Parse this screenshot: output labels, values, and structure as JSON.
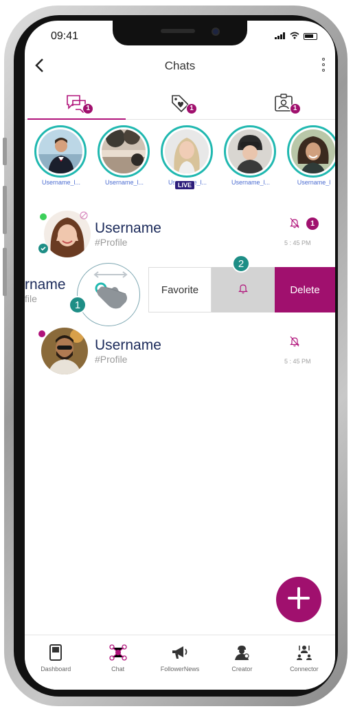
{
  "status_bar": {
    "time": "09:41"
  },
  "header": {
    "title": "Chats"
  },
  "tabs": [
    {
      "icon": "chat-bubbles-icon",
      "badge": "1",
      "active": true
    },
    {
      "icon": "heart-tag-icon",
      "badge": "1",
      "active": false
    },
    {
      "icon": "contact-card-icon",
      "badge": "1",
      "active": false
    }
  ],
  "stories": [
    {
      "label": "Username_l...",
      "live": false
    },
    {
      "label": "Username_l...",
      "live": false
    },
    {
      "label": "Username_l...",
      "live": true,
      "live_text": "LIVE"
    },
    {
      "label": "Username_l...",
      "live": false
    },
    {
      "label": "Username_l",
      "live": false
    }
  ],
  "chats": [
    {
      "name": "Username",
      "profile": "#Profile",
      "time": "5 : 45 PM",
      "unread": "1",
      "muted": true
    },
    {
      "name": "Username",
      "profile": "#Profile",
      "time": "5 : 45 PM",
      "muted": true
    }
  ],
  "swiped_chat": {
    "name_partial": "rname",
    "profile_partial": "file"
  },
  "swipe_actions": {
    "favorite": "Favorite",
    "mute_icon": "bell-icon",
    "delete": "Delete"
  },
  "hints": {
    "first": "1",
    "second": "2"
  },
  "bottom_nav": [
    {
      "label": "Dashboard",
      "icon": "dashboard-icon"
    },
    {
      "label": "Chat",
      "icon": "chat-network-icon",
      "active": true
    },
    {
      "label": "FollowerNews",
      "icon": "megaphone-icon"
    },
    {
      "label": "Creator",
      "icon": "creator-icon"
    },
    {
      "label": "Connector",
      "icon": "connector-icon"
    }
  ],
  "colors": {
    "accent": "#a0106e",
    "ring": "#20b8b0",
    "hint": "#1e8e86",
    "name": "#1b2a5a"
  }
}
